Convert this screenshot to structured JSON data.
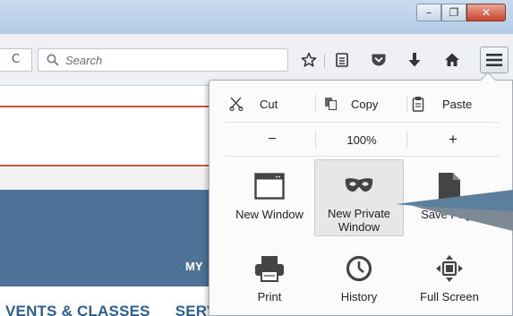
{
  "window": {
    "minimize_icon": "minimize-icon",
    "minimize_glyph": "–",
    "maximize_icon": "maximize-icon",
    "maximize_glyph": "❐",
    "close_icon": "close-icon",
    "close_glyph": "✕"
  },
  "navbar": {
    "reload_glyph": "C",
    "search_placeholder": "Search",
    "icons": [
      "bookmark-star-icon",
      "reading-list-icon",
      "pocket-icon",
      "download-icon",
      "home-icon",
      "hamburger-menu-icon"
    ]
  },
  "page": {
    "band_text": "MY",
    "nav_items": [
      "VENTS & CLASSES",
      "SERV"
    ],
    "colors": {
      "band": "#4d7197",
      "accent_line": "#c9553e",
      "nav_text": "#2e5f8e"
    }
  },
  "menu": {
    "cut_label": "Cut",
    "copy_label": "Copy",
    "paste_label": "Paste",
    "zoom_out": "−",
    "zoom_level": "100%",
    "zoom_in": "+",
    "items": [
      {
        "label": "New Window",
        "icon": "new-window-icon"
      },
      {
        "label": "New Private Window",
        "icon": "private-mask-icon"
      },
      {
        "label": "Save Page",
        "icon": "save-page-icon"
      },
      {
        "label": "Print",
        "icon": "print-icon"
      },
      {
        "label": "History",
        "icon": "history-clock-icon"
      },
      {
        "label": "Full Screen",
        "icon": "fullscreen-icon"
      }
    ]
  }
}
